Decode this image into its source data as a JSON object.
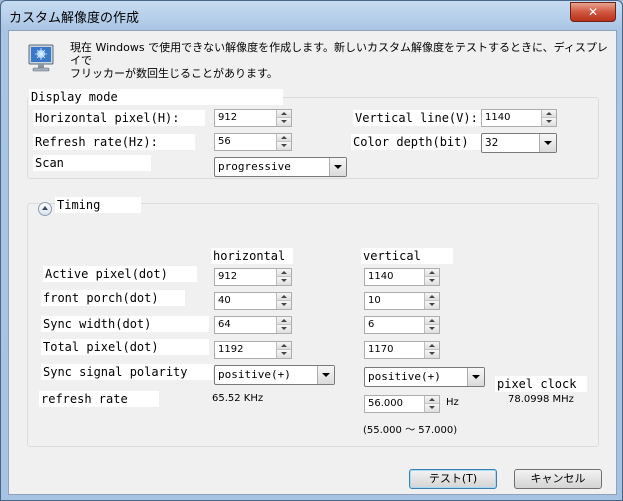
{
  "window": {
    "title": "カスタム解像度の作成",
    "close_label": "✕"
  },
  "info": {
    "icon": "monitor-icon",
    "line1": "現在 Windows で使用できない解像度を作成します。新しいカスタム解像度をテストするときに、ディスプレイで",
    "line2": "フリッカーが数回生じることがあります。"
  },
  "display_mode": {
    "title": "Display mode",
    "horizontal_pixel": {
      "label": "Horizontal pixel(H):",
      "value": "912"
    },
    "vertical_line": {
      "label": "Vertical line(V):",
      "value": "1140"
    },
    "refresh_rate": {
      "label": "Refresh rate(Hz):",
      "value": "56"
    },
    "color_depth": {
      "label": "Color depth(bit)",
      "value": "32"
    },
    "scan": {
      "label": "Scan",
      "value": "progressive"
    }
  },
  "timing": {
    "title": "Timing",
    "col_horizontal": "horizontal",
    "col_vertical": "vertical",
    "rows": [
      {
        "label": "Active pixel(dot)",
        "h": "912",
        "v": "1140"
      },
      {
        "label": "front porch(dot)",
        "h": "40",
        "v": "10"
      },
      {
        "label": "Sync width(dot)",
        "h": "64",
        "v": "6"
      },
      {
        "label": "Total pixel(dot)",
        "h": "1192",
        "v": "1170"
      }
    ],
    "sync_polarity": {
      "label": "Sync signal polarity",
      "h": "positive(+)",
      "v": "positive(+)"
    },
    "refresh": {
      "label": "refresh rate",
      "h_value": "65.52 KHz",
      "v_value": "56.000",
      "v_unit": "Hz",
      "range": "(55.000 ～ 57.000)"
    },
    "pixel_clock": {
      "label": "pixel clock",
      "value": "78.0998 MHz"
    }
  },
  "buttons": {
    "test": "テスト(T)",
    "cancel": "キャンセル"
  }
}
